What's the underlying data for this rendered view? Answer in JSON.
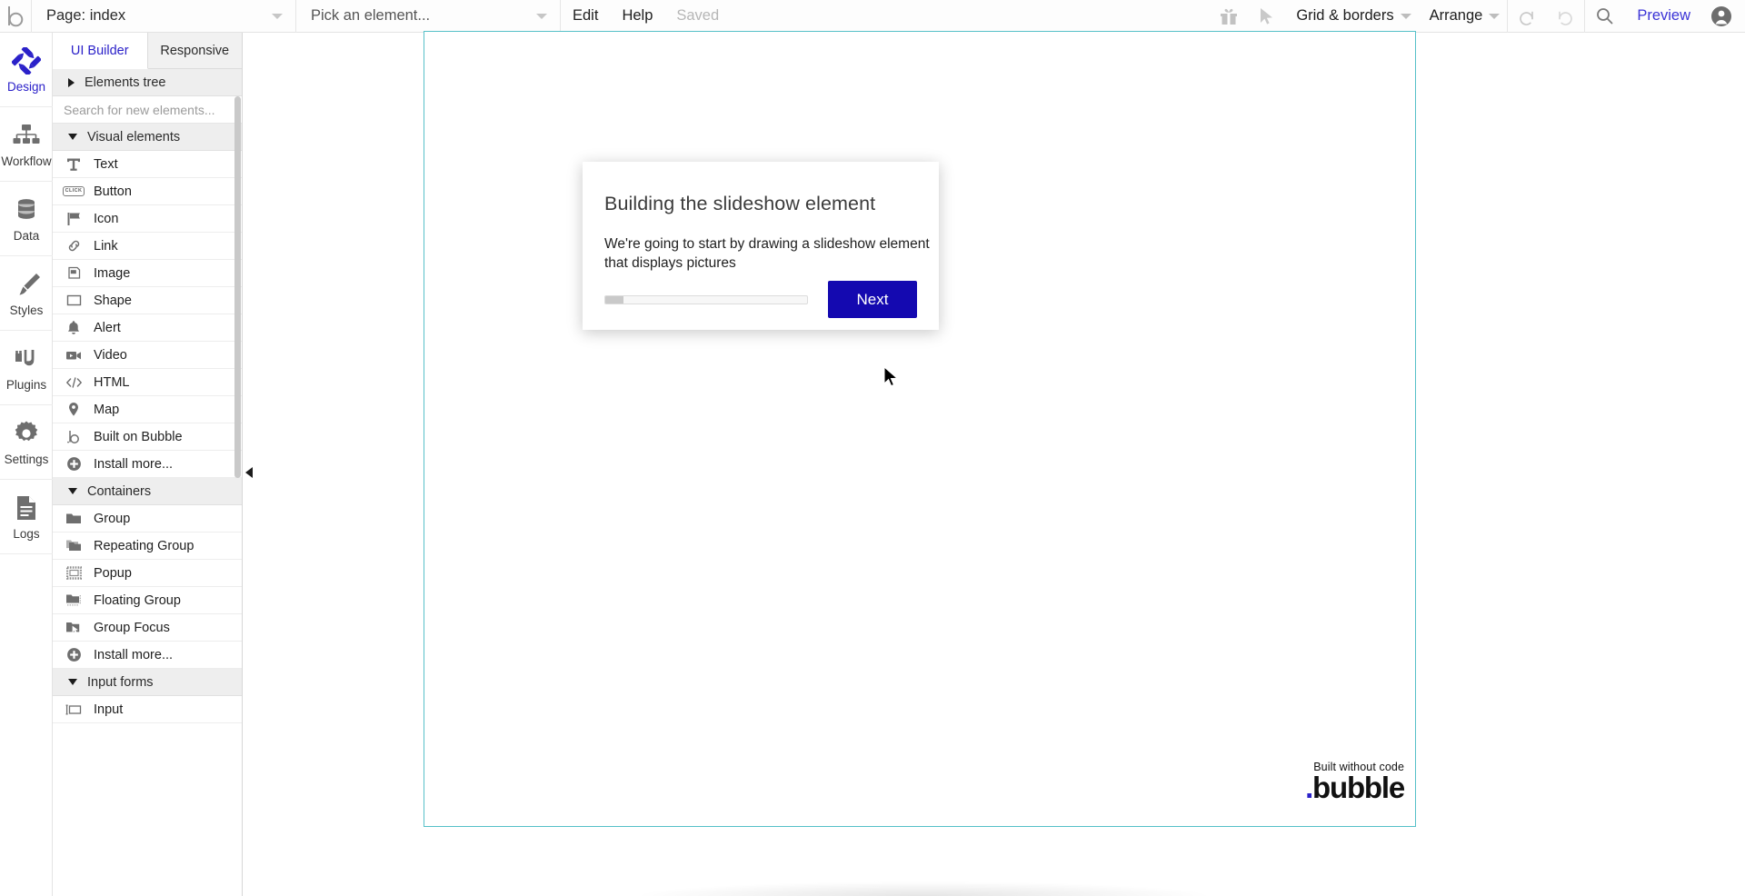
{
  "topbar": {
    "logo_icon": "bubble-b-logo",
    "page_select": {
      "label": "Page: index",
      "icon": "chevron-down-icon"
    },
    "element_select": {
      "placeholder": "Pick an element...",
      "icon": "chevron-down-icon"
    },
    "menus": [
      {
        "label": "Edit",
        "name": "edit-menu"
      },
      {
        "label": "Help",
        "name": "help-menu"
      }
    ],
    "status": "Saved",
    "gift_icon": "gift-icon",
    "pointer_icon": "cursor-arrow-icon",
    "grid_dropdown": "Grid & borders",
    "arrange_dropdown": "Arrange",
    "undo_icon": "undo-icon",
    "redo_icon": "redo-icon",
    "search_icon": "search-icon",
    "preview": "Preview",
    "avatar_icon": "user-avatar-icon"
  },
  "rail": {
    "items": [
      {
        "label": "Design",
        "icon": "design-pencils-icon",
        "active": true
      },
      {
        "label": "Workflow",
        "icon": "workflow-hierarchy-icon",
        "active": false
      },
      {
        "label": "Data",
        "icon": "database-icon",
        "active": false
      },
      {
        "label": "Styles",
        "icon": "paintbrush-icon",
        "active": false
      },
      {
        "label": "Plugins",
        "icon": "plug-icon",
        "active": false
      },
      {
        "label": "Settings",
        "icon": "gear-icon",
        "active": false
      },
      {
        "label": "Logs",
        "icon": "document-lines-icon",
        "active": false
      }
    ]
  },
  "panel": {
    "tabs": [
      {
        "label": "UI Builder",
        "active": true
      },
      {
        "label": "Responsive",
        "active": false
      }
    ],
    "elements_tree": {
      "label": "Elements tree",
      "expanded": false
    },
    "search_placeholder": "Search for new elements...",
    "sections": [
      {
        "title": "Visual elements",
        "expanded": true,
        "items": [
          {
            "label": "Text",
            "icon": "text-serif-T-icon"
          },
          {
            "label": "Button",
            "icon": "button-click-icon"
          },
          {
            "label": "Icon",
            "icon": "flag-icon"
          },
          {
            "label": "Link",
            "icon": "chain-link-icon"
          },
          {
            "label": "Image",
            "icon": "image-icon"
          },
          {
            "label": "Shape",
            "icon": "rectangle-shape-icon"
          },
          {
            "label": "Alert",
            "icon": "bell-icon"
          },
          {
            "label": "Video",
            "icon": "video-camera-icon"
          },
          {
            "label": "HTML",
            "icon": "code-brackets-icon"
          },
          {
            "label": "Map",
            "icon": "map-pin-icon"
          },
          {
            "label": "Built on Bubble",
            "icon": "bubble-b-icon"
          },
          {
            "label": "Install more...",
            "icon": "plus-circle-icon"
          }
        ]
      },
      {
        "title": "Containers",
        "expanded": true,
        "items": [
          {
            "label": "Group",
            "icon": "folder-icon"
          },
          {
            "label": "Repeating Group",
            "icon": "folders-stack-icon"
          },
          {
            "label": "Popup",
            "icon": "popup-frame-icon"
          },
          {
            "label": "Floating Group",
            "icon": "floating-folder-icon"
          },
          {
            "label": "Group Focus",
            "icon": "folder-cursor-icon"
          },
          {
            "label": "Install more...",
            "icon": "plus-circle-icon"
          }
        ]
      },
      {
        "title": "Input forms",
        "expanded": true,
        "items": [
          {
            "label": "Input",
            "icon": "input-field-icon"
          }
        ]
      }
    ]
  },
  "modal": {
    "title": "Building the slideshow element",
    "body": "We're going to start by drawing a slideshow element that displays pictures",
    "progress_percent": 9,
    "next_label": "Next"
  },
  "canvas": {
    "watermark_top": "Built without code",
    "watermark_logo": "bubble",
    "watermark_dot": ".",
    "frame_border_color": "#56c0c8"
  },
  "colors": {
    "accent_blue": "#2b21c9",
    "button_blue": "#1409b0",
    "panel_gray": "#eeeeee",
    "muted_text": "#b6b6b6"
  }
}
